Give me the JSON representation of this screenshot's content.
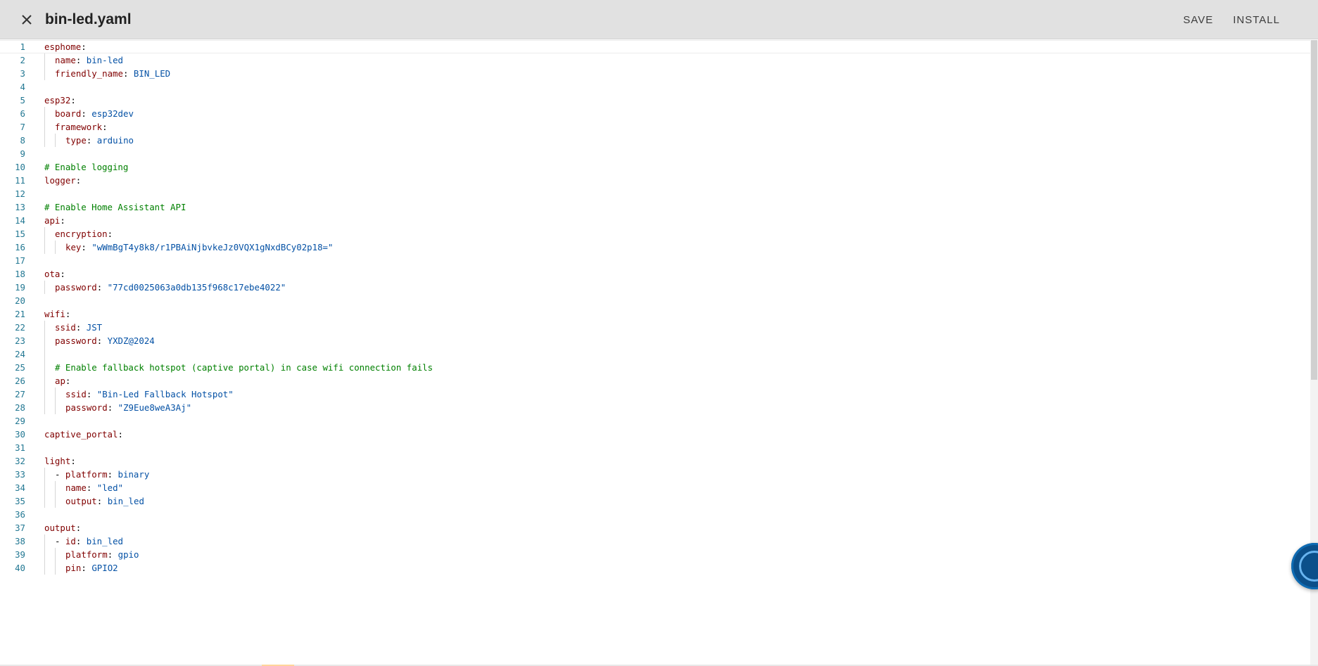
{
  "header": {
    "title": "bin-led.yaml",
    "close_icon": "close-icon",
    "save_label": "SAVE",
    "install_label": "INSTALL"
  },
  "colors": {
    "key": "#800000",
    "value": "#0451a5",
    "comment": "#008000",
    "line_number": "#237893",
    "header_bg": "#e1e1e1"
  },
  "editor": {
    "active_line": 1,
    "lines": [
      {
        "n": "1",
        "indent": 0,
        "tokens": [
          {
            "t": "k",
            "s": "esphome"
          },
          {
            "t": "p",
            "s": ":"
          }
        ]
      },
      {
        "n": "2",
        "indent": 1,
        "tokens": [
          {
            "t": "k",
            "s": "name"
          },
          {
            "t": "p",
            "s": ": "
          },
          {
            "t": "v",
            "s": "bin-led"
          }
        ]
      },
      {
        "n": "3",
        "indent": 1,
        "tokens": [
          {
            "t": "k",
            "s": "friendly_name"
          },
          {
            "t": "p",
            "s": ": "
          },
          {
            "t": "v",
            "s": "BIN_LED"
          }
        ]
      },
      {
        "n": "4",
        "indent": 0,
        "tokens": []
      },
      {
        "n": "5",
        "indent": 0,
        "tokens": [
          {
            "t": "k",
            "s": "esp32"
          },
          {
            "t": "p",
            "s": ":"
          }
        ]
      },
      {
        "n": "6",
        "indent": 1,
        "tokens": [
          {
            "t": "k",
            "s": "board"
          },
          {
            "t": "p",
            "s": ": "
          },
          {
            "t": "v",
            "s": "esp32dev"
          }
        ]
      },
      {
        "n": "7",
        "indent": 1,
        "tokens": [
          {
            "t": "k",
            "s": "framework"
          },
          {
            "t": "p",
            "s": ":"
          }
        ]
      },
      {
        "n": "8",
        "indent": 2,
        "tokens": [
          {
            "t": "k",
            "s": "type"
          },
          {
            "t": "p",
            "s": ": "
          },
          {
            "t": "v",
            "s": "arduino"
          }
        ]
      },
      {
        "n": "9",
        "indent": 0,
        "tokens": []
      },
      {
        "n": "10",
        "indent": 0,
        "tokens": [
          {
            "t": "c",
            "s": "# Enable logging"
          }
        ]
      },
      {
        "n": "11",
        "indent": 0,
        "tokens": [
          {
            "t": "k",
            "s": "logger"
          },
          {
            "t": "p",
            "s": ":"
          }
        ]
      },
      {
        "n": "12",
        "indent": 0,
        "tokens": []
      },
      {
        "n": "13",
        "indent": 0,
        "tokens": [
          {
            "t": "c",
            "s": "# Enable Home Assistant API"
          }
        ]
      },
      {
        "n": "14",
        "indent": 0,
        "tokens": [
          {
            "t": "k",
            "s": "api"
          },
          {
            "t": "p",
            "s": ":"
          }
        ]
      },
      {
        "n": "15",
        "indent": 1,
        "tokens": [
          {
            "t": "k",
            "s": "encryption"
          },
          {
            "t": "p",
            "s": ":"
          }
        ]
      },
      {
        "n": "16",
        "indent": 2,
        "tokens": [
          {
            "t": "k",
            "s": "key"
          },
          {
            "t": "p",
            "s": ": "
          },
          {
            "t": "v",
            "s": "\"wWmBgT4y8k8/r1PBAiNjbvkeJz0VQX1gNxdBCy02p18=\""
          }
        ]
      },
      {
        "n": "17",
        "indent": 0,
        "tokens": []
      },
      {
        "n": "18",
        "indent": 0,
        "tokens": [
          {
            "t": "k",
            "s": "ota"
          },
          {
            "t": "p",
            "s": ":"
          }
        ]
      },
      {
        "n": "19",
        "indent": 1,
        "tokens": [
          {
            "t": "k",
            "s": "password"
          },
          {
            "t": "p",
            "s": ": "
          },
          {
            "t": "v",
            "s": "\"77cd0025063a0db135f968c17ebe4022\""
          }
        ]
      },
      {
        "n": "20",
        "indent": 0,
        "tokens": []
      },
      {
        "n": "21",
        "indent": 0,
        "tokens": [
          {
            "t": "k",
            "s": "wifi"
          },
          {
            "t": "p",
            "s": ":"
          }
        ]
      },
      {
        "n": "22",
        "indent": 1,
        "tokens": [
          {
            "t": "k",
            "s": "ssid"
          },
          {
            "t": "p",
            "s": ": "
          },
          {
            "t": "v",
            "s": "JST"
          }
        ]
      },
      {
        "n": "23",
        "indent": 1,
        "tokens": [
          {
            "t": "k",
            "s": "password"
          },
          {
            "t": "p",
            "s": ": "
          },
          {
            "t": "v",
            "s": "YXDZ@2024"
          }
        ]
      },
      {
        "n": "24",
        "indent": 1,
        "tokens": []
      },
      {
        "n": "25",
        "indent": 1,
        "tokens": [
          {
            "t": "c",
            "s": "# Enable fallback hotspot (captive portal) in case wifi connection fails"
          }
        ]
      },
      {
        "n": "26",
        "indent": 1,
        "tokens": [
          {
            "t": "k",
            "s": "ap"
          },
          {
            "t": "p",
            "s": ":"
          }
        ]
      },
      {
        "n": "27",
        "indent": 2,
        "tokens": [
          {
            "t": "k",
            "s": "ssid"
          },
          {
            "t": "p",
            "s": ": "
          },
          {
            "t": "v",
            "s": "\"Bin-Led Fallback Hotspot\""
          }
        ]
      },
      {
        "n": "28",
        "indent": 2,
        "tokens": [
          {
            "t": "k",
            "s": "password"
          },
          {
            "t": "p",
            "s": ": "
          },
          {
            "t": "v",
            "s": "\"Z9Eue8weA3Aj\""
          }
        ]
      },
      {
        "n": "29",
        "indent": 0,
        "tokens": []
      },
      {
        "n": "30",
        "indent": 0,
        "tokens": [
          {
            "t": "k",
            "s": "captive_portal"
          },
          {
            "t": "p",
            "s": ":"
          }
        ]
      },
      {
        "n": "31",
        "indent": 0,
        "tokens": []
      },
      {
        "n": "32",
        "indent": 0,
        "tokens": [
          {
            "t": "k",
            "s": "light"
          },
          {
            "t": "p",
            "s": ":"
          }
        ]
      },
      {
        "n": "33",
        "indent": 1,
        "tokens": [
          {
            "t": "p",
            "s": "- "
          },
          {
            "t": "k",
            "s": "platform"
          },
          {
            "t": "p",
            "s": ": "
          },
          {
            "t": "v",
            "s": "binary"
          }
        ]
      },
      {
        "n": "34",
        "indent": 2,
        "tokens": [
          {
            "t": "k",
            "s": "name"
          },
          {
            "t": "p",
            "s": ": "
          },
          {
            "t": "v",
            "s": "\"led\""
          }
        ]
      },
      {
        "n": "35",
        "indent": 2,
        "tokens": [
          {
            "t": "k",
            "s": "output"
          },
          {
            "t": "p",
            "s": ": "
          },
          {
            "t": "v",
            "s": "bin_led"
          }
        ]
      },
      {
        "n": "36",
        "indent": 0,
        "tokens": []
      },
      {
        "n": "37",
        "indent": 0,
        "tokens": [
          {
            "t": "k",
            "s": "output"
          },
          {
            "t": "p",
            "s": ":"
          }
        ]
      },
      {
        "n": "38",
        "indent": 1,
        "tokens": [
          {
            "t": "p",
            "s": "- "
          },
          {
            "t": "k",
            "s": "id"
          },
          {
            "t": "p",
            "s": ": "
          },
          {
            "t": "v",
            "s": "bin_led"
          }
        ]
      },
      {
        "n": "39",
        "indent": 2,
        "tokens": [
          {
            "t": "k",
            "s": "platform"
          },
          {
            "t": "p",
            "s": ": "
          },
          {
            "t": "v",
            "s": "gpio"
          }
        ]
      },
      {
        "n": "40",
        "indent": 2,
        "tokens": [
          {
            "t": "k",
            "s": "pin"
          },
          {
            "t": "p",
            "s": ": "
          },
          {
            "t": "v",
            "s": "GPIO2"
          }
        ]
      }
    ]
  }
}
